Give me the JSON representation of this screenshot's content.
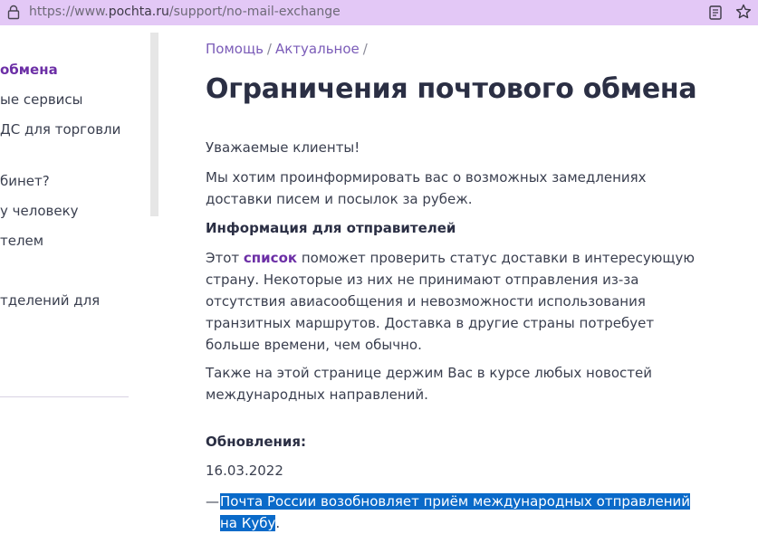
{
  "browser": {
    "url_prefix": "https://www.",
    "url_host": "pochta.ru",
    "url_path": "/support/no-mail-exchange"
  },
  "sidebar": {
    "items": [
      {
        "label": "обмена",
        "active": true
      },
      {
        "label": "ые сервисы"
      },
      {
        "label": "ДС для торговли"
      },
      {
        "label": "бинет?"
      },
      {
        "label": "у человеку"
      },
      {
        "label": "телем"
      },
      {
        "label": "тделений для"
      }
    ]
  },
  "breadcrumbs": {
    "items": [
      "Помощь",
      "Актуальное"
    ],
    "sep": "/"
  },
  "page": {
    "title": "Ограничения почтового обмена",
    "greeting": "Уважаемые клиенты!",
    "intro": "Мы хотим проинформировать вас о возможных замедлениях доставки писем и посылок за рубеж.",
    "senders_heading": "Информация для отправителей",
    "list_text_before": "Этот ",
    "list_link": "список",
    "list_text_after": " поможет проверить статус доставки в интересующую страну. Некоторые из них не принимают отправления из-за отсутствия авиасообщения и невозможности использования транзитных маршрутов. Доставка в другие страны потребует больше времени, чем обычно.",
    "also": "Также на этой странице держим Вас в курсе любых новостей международных направлений.",
    "updates_heading": "Обновления:",
    "update_date": "16.03.2022",
    "update_dash": "—",
    "update_link": "Почта России возобновляет приём международных отправлений на Кубу",
    "update_end": "."
  },
  "colors": {
    "accent": "#6c2fa6",
    "addressbar": "#e3c8f6",
    "selection": "#0a6ac9"
  }
}
